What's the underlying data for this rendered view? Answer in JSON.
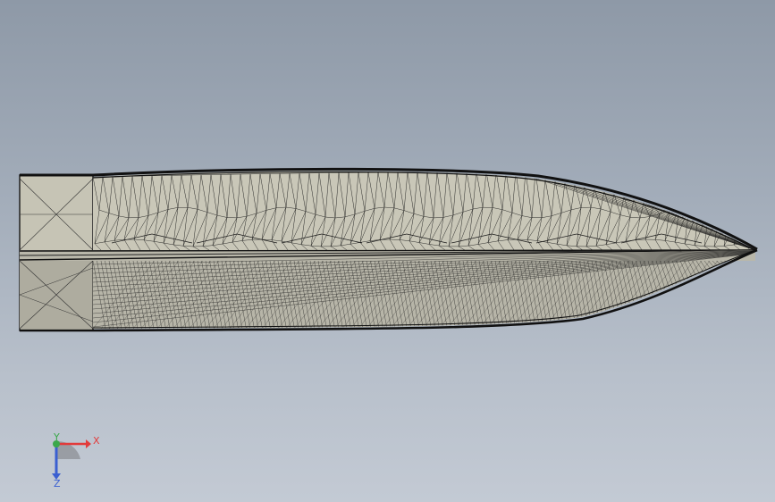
{
  "viewport": {
    "model": {
      "type": "wireframe-mesh",
      "face_color": "#c8c6b8",
      "edge_color": "#1a1a1a"
    },
    "triad": {
      "x_label": "X",
      "y_label": "Y",
      "z_label": "Z",
      "x_color": "#e23b3b",
      "y_color": "#3aa84a",
      "z_color": "#3a5fd1"
    }
  }
}
